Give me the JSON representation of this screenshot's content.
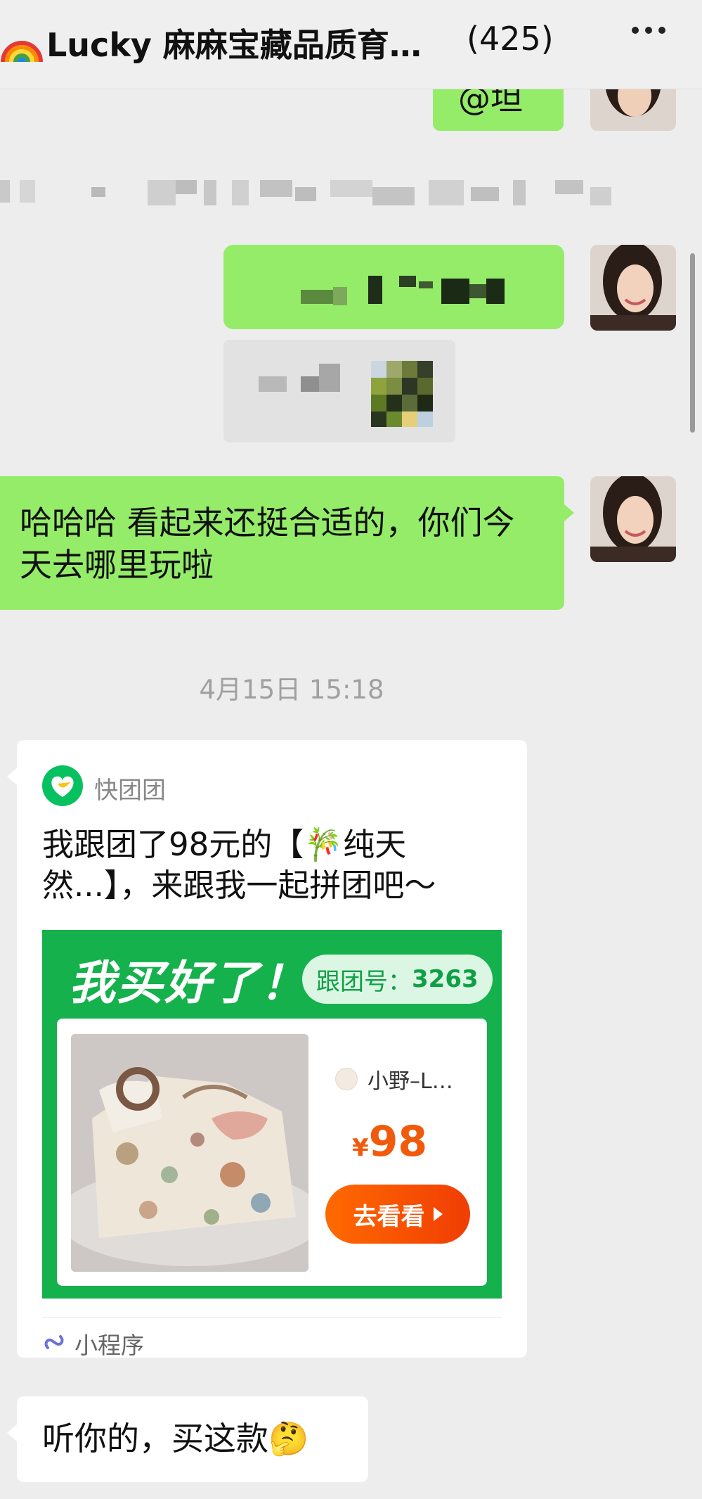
{
  "header": {
    "title": "Lucky 麻麻宝藏品质育…",
    "member_count": "(425)",
    "more_icon": "more-dots-icon"
  },
  "messages": {
    "partial_top_text": "@​坦",
    "sent_text": "哈哈哈 看起来还挺合适的，你们今天去哪里玩啦",
    "timestamp": "4月15日 15:18",
    "reply_text": "听你的，买这款",
    "reply_emoji": "🤔"
  },
  "card": {
    "app_name": "快团团",
    "title": "我跟团了98元的【🎋纯天然...】，来跟我一起拼团吧～",
    "promo_headline": "我买好了！",
    "group_label": "跟团号：",
    "group_number": "3263",
    "store_name": "小野–L…",
    "price_symbol": "¥",
    "price": "98",
    "button_label": "去看看",
    "footer_label": "小程序"
  },
  "colors": {
    "green_bubble": "#95ec69",
    "promo_green": "#14b14c",
    "price_orange": "#f15a0a"
  }
}
